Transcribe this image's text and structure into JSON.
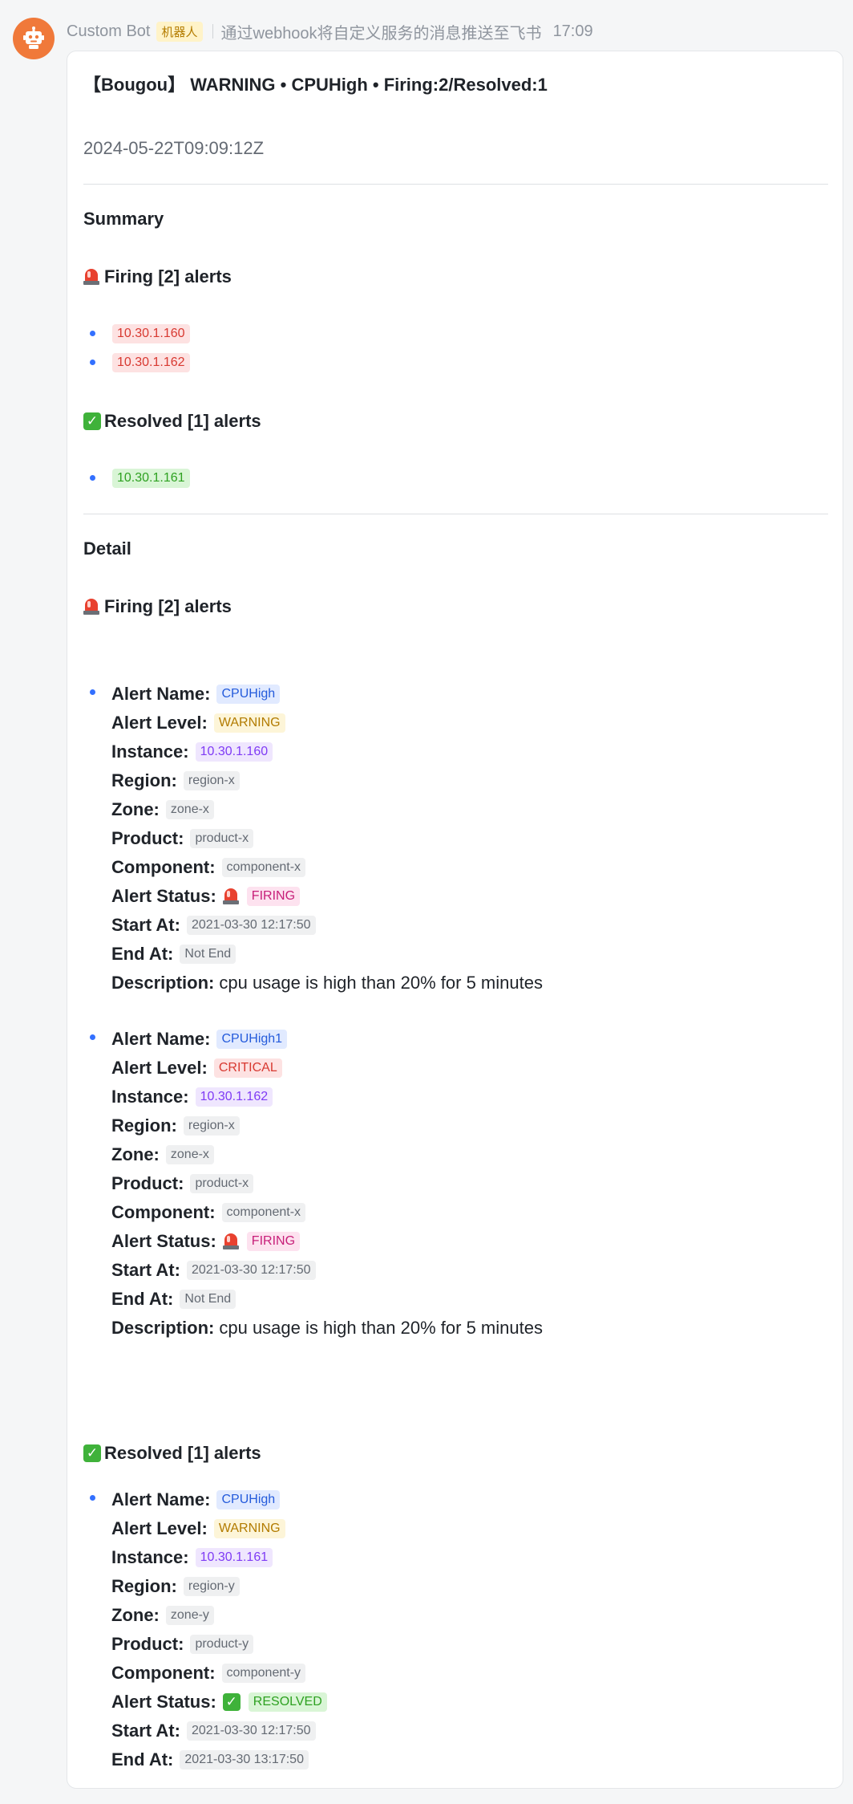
{
  "header": {
    "bot_name": "Custom Bot",
    "bot_badge": "机器人",
    "description": "通过webhook将自定义服务的消息推送至飞书",
    "time": "17:09"
  },
  "card": {
    "title": "【Bougou】 WARNING • CPUHigh • Firing:2/Resolved:1",
    "timestamp": "2024-05-22T09:09:12Z",
    "summary": {
      "heading": "Summary",
      "firing_heading": "Firing [2] alerts",
      "firing_instances": [
        "10.30.1.160",
        "10.30.1.162"
      ],
      "resolved_heading": "Resolved [1] alerts",
      "resolved_instances": [
        "10.30.1.161"
      ]
    },
    "detail": {
      "heading": "Detail",
      "firing_heading": "Firing [2] alerts",
      "resolved_heading": "Resolved [1] alerts",
      "labels": {
        "alert_name": "Alert Name:",
        "alert_level": "Alert Level:",
        "instance": "Instance:",
        "region": "Region:",
        "zone": "Zone:",
        "product": "Product:",
        "component": "Component:",
        "alert_status": "Alert Status:",
        "start_at": "Start At:",
        "end_at": "End At:",
        "description": "Description:"
      },
      "alerts": [
        {
          "alert_name": "CPUHigh",
          "alert_level": "WARNING",
          "instance": "10.30.1.160",
          "region": "region-x",
          "zone": "zone-x",
          "product": "product-x",
          "component": "component-x",
          "alert_status": "FIRING",
          "start_at": "2021-03-30 12:17:50",
          "end_at": "Not End",
          "description": "cpu usage is high than 20% for 5 minutes"
        },
        {
          "alert_name": "CPUHigh1",
          "alert_level": "CRITICAL",
          "instance": "10.30.1.162",
          "region": "region-x",
          "zone": "zone-x",
          "product": "product-x",
          "component": "component-x",
          "alert_status": "FIRING",
          "start_at": "2021-03-30 12:17:50",
          "end_at": "Not End",
          "description": "cpu usage is high than 20% for 5 minutes"
        },
        {
          "alert_name": "CPUHigh",
          "alert_level": "WARNING",
          "instance": "10.30.1.161",
          "region": "region-y",
          "zone": "zone-y",
          "product": "product-y",
          "component": "component-y",
          "alert_status": "RESOLVED",
          "start_at": "2021-03-30 12:17:50",
          "end_at": "2021-03-30 13:17:50"
        }
      ]
    }
  },
  "colors": {
    "avatar": "#f0793a",
    "accent_blue": "#3370ff",
    "firing_red": "#d83931",
    "resolved_green": "#2ea121"
  },
  "icons": [
    "robot-icon",
    "siren-icon",
    "check-icon"
  ]
}
